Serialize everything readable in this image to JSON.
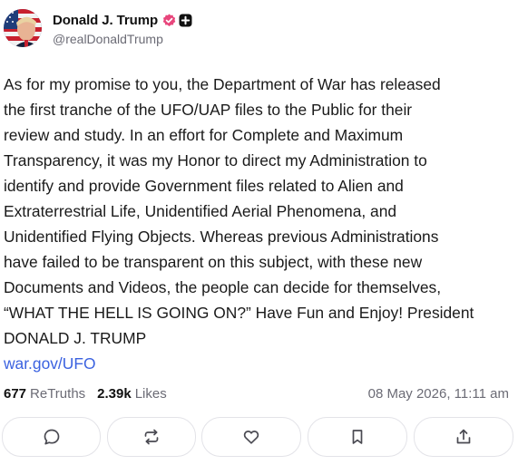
{
  "post": {
    "author": {
      "display_name": "Donald J. Trump",
      "handle": "@realDonaldTrump",
      "verified_badge_color": "#e8467c",
      "avatar_icon": "avatar-flag-portrait"
    },
    "text": "As for my promise to you, the Department of War has released\nthe first tranche of the UFO/UAP files to the Public for their\nreview and study. In an effort for Complete and Maximum\nTransparency, it was my Honor to direct my Administration to\nidentify and provide Government files related to Alien and\nExtraterrestrial Life, Unidentified Aerial Phenomena, and\nUnidentified Flying Objects. Whereas previous Administrations\nhave failed to be transparent on this subject, with these new\nDocuments and Videos, the people can decide for themselves,\n“WHAT THE HELL IS GOING ON?” Have Fun and Enjoy! President\nDONALD J. TRUMP",
    "link": "war.gov/UFO",
    "link_color": "#3b62e0",
    "stats": {
      "retruths_count": "677",
      "retruths_label": "ReTruths",
      "likes_count": "2.39k",
      "likes_label": "Likes"
    },
    "timestamp": "08 May 2026, 11:11 am"
  },
  "actions": [
    {
      "name": "reply",
      "icon": "comment-icon"
    },
    {
      "name": "retruth",
      "icon": "repost-icon"
    },
    {
      "name": "like",
      "icon": "heart-icon"
    },
    {
      "name": "bookmark",
      "icon": "bookmark-icon"
    },
    {
      "name": "share",
      "icon": "share-icon"
    }
  ]
}
